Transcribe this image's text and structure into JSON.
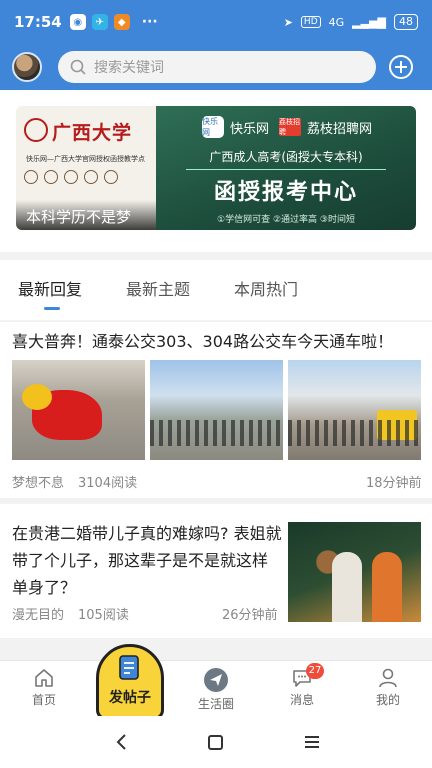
{
  "status_bar": {
    "time": "17:54",
    "more": "···",
    "network": "4G",
    "battery": "48",
    "hd": "HD"
  },
  "header": {
    "search_placeholder": "搜索关键词",
    "add_icon": "plus-circle-icon",
    "search_icon": "search-icon"
  },
  "banner": {
    "left": {
      "university": "广西大学",
      "subtitle": "快乐网—广西大学官网授权函授教学点",
      "caption": "本科学历不是梦"
    },
    "right": {
      "brand1": "快乐网",
      "brand1_icon": "快乐网",
      "brand2": "荔枝招聘网",
      "brand2_icon": "荔枝招聘",
      "subtitle": "广西成人高考(函授大专本科)",
      "title": "函授报考中心",
      "features": "①学信网可查 ②通过率高 ③时间短"
    }
  },
  "tabs": [
    {
      "label": "最新回复",
      "active": true
    },
    {
      "label": "最新主题",
      "active": false
    },
    {
      "label": "本周热门",
      "active": false
    }
  ],
  "posts": [
    {
      "title": "喜大普奔！通泰公交303、304路公交车今天通车啦！",
      "author": "梦想不息",
      "reads": "3104阅读",
      "time": "18分钟前"
    },
    {
      "title": "在贵港二婚带儿子真的难嫁吗? 表姐就带了个儿子，那这辈子是不是就这样单身了？",
      "author": "漫无目的",
      "reads": "105阅读",
      "time": "26分钟前"
    }
  ],
  "bottom_nav": [
    {
      "label": "首页",
      "icon": "home-icon"
    },
    {
      "label": "发帖子",
      "icon": "compose-icon"
    },
    {
      "label": "生活圈",
      "icon": "paper-plane-icon"
    },
    {
      "label": "消息",
      "icon": "chat-icon",
      "badge": "27"
    },
    {
      "label": "我的",
      "icon": "profile-icon"
    }
  ],
  "colors": {
    "primary": "#3f86d8",
    "post_button": "#f8d339",
    "badge": "#ef4d3c"
  }
}
